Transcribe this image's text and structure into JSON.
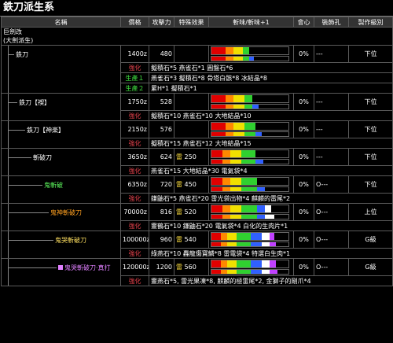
{
  "page_title": "鉄刀派生系",
  "headers": [
    "名稱",
    "價格",
    "攻擊力",
    "特殊效果",
    "斬味/斬味+1",
    "會心",
    "裝飾孔",
    "製作級別"
  ],
  "tree_labels": {
    "root": "巨劍改",
    "root_sub": "(大劍派生)",
    "n1": "鉄刀",
    "n2": "鉄刀【禊】",
    "n3": "鉄刀【神楽】",
    "n4": "斬破刀",
    "n5": "鬼斬破",
    "n6": "鬼神斬破刀",
    "n7": "鬼哭斬破刀",
    "n8": "鬼哭斬破刀·真打"
  },
  "labels": {
    "kyouka": "強化",
    "seisan1": "生產１",
    "seisan2": "生產２",
    "no_slot": "---",
    "slot1": "O---"
  },
  "rows": [
    {
      "price": "1400z",
      "atk": "480",
      "elem": "",
      "affinity": "0%",
      "slots": "---",
      "rank": "下位",
      "mats": [
        {
          "tag": "強化",
          "text": "擬積石*5 燕雀石*1 圓盤石*6"
        },
        {
          "tag": "生產１",
          "text": "燕雀石*3 擬積石*8 骨塔白骸*8 冰結晶*8"
        },
        {
          "tag": "生產２",
          "text": "累H*1 擬積石*1"
        }
      ],
      "sharp": [
        [
          18,
          "#e00000"
        ],
        [
          10,
          "#ff8800"
        ],
        [
          12,
          "#f0e000"
        ],
        [
          8,
          "#30d030"
        ]
      ],
      "sharp2": [
        [
          18,
          "#e00000"
        ],
        [
          10,
          "#ff8800"
        ],
        [
          12,
          "#f0e000"
        ],
        [
          8,
          "#30d030"
        ],
        [
          6,
          "#3060ff"
        ]
      ]
    },
    {
      "price": "1750z",
      "atk": "528",
      "elem": "",
      "affinity": "0%",
      "slots": "---",
      "rank": "下位",
      "mats": [
        {
          "tag": "強化",
          "text": "擬積石*10 燕雀石*10 大地結晶*10"
        }
      ],
      "sharp": [
        [
          18,
          "#e00000"
        ],
        [
          10,
          "#ff8800"
        ],
        [
          14,
          "#f0e000"
        ],
        [
          10,
          "#30d030"
        ]
      ],
      "sharp2": [
        [
          18,
          "#e00000"
        ],
        [
          10,
          "#ff8800"
        ],
        [
          14,
          "#f0e000"
        ],
        [
          10,
          "#30d030"
        ],
        [
          8,
          "#3060ff"
        ]
      ]
    },
    {
      "price": "2150z",
      "atk": "576",
      "elem": "",
      "affinity": "0%",
      "slots": "---",
      "rank": "下位",
      "mats": [
        {
          "tag": "強化",
          "text": "擬積石*15 燕雀石*12 大地結晶*15"
        }
      ],
      "sharp": [
        [
          18,
          "#e00000"
        ],
        [
          10,
          "#ff8800"
        ],
        [
          14,
          "#f0e000"
        ],
        [
          14,
          "#30d030"
        ]
      ],
      "sharp2": [
        [
          18,
          "#e00000"
        ],
        [
          10,
          "#ff8800"
        ],
        [
          14,
          "#f0e000"
        ],
        [
          14,
          "#30d030"
        ],
        [
          8,
          "#3060ff"
        ]
      ]
    },
    {
      "price": "3650z",
      "atk": "624",
      "elem": "雷 250",
      "affinity": "0%",
      "slots": "---",
      "rank": "下位",
      "mats": [
        {
          "tag": "強化",
          "text": "燕雀石*15 大地結晶*30 電氣袋*4"
        }
      ],
      "sharp": [
        [
          14,
          "#e00000"
        ],
        [
          10,
          "#ff8800"
        ],
        [
          14,
          "#f0e000"
        ],
        [
          18,
          "#30d030"
        ]
      ],
      "sharp2": [
        [
          14,
          "#e00000"
        ],
        [
          10,
          "#ff8800"
        ],
        [
          14,
          "#f0e000"
        ],
        [
          18,
          "#30d030"
        ],
        [
          10,
          "#3060ff"
        ]
      ]
    },
    {
      "price": "6350z",
      "atk": "720",
      "elem": "雷 450",
      "affinity": "0%",
      "slots": "O---",
      "rank": "下位",
      "mats": [
        {
          "tag": "強化",
          "text": "鎌鼬石*5 燕雀石*20 雷光袋出物*4 麒麟的雷尾*2"
        }
      ],
      "sharp": [
        [
          14,
          "#e00000"
        ],
        [
          10,
          "#ff8800"
        ],
        [
          14,
          "#f0e000"
        ],
        [
          20,
          "#30d030"
        ]
      ],
      "sharp2": [
        [
          14,
          "#e00000"
        ],
        [
          10,
          "#ff8800"
        ],
        [
          14,
          "#f0e000"
        ],
        [
          20,
          "#30d030"
        ],
        [
          10,
          "#3060ff"
        ]
      ]
    },
    {
      "price": "70000z",
      "atk": "816",
      "elem": "雷 520",
      "affinity": "0%",
      "slots": "O---",
      "rank": "上位",
      "mats": [
        {
          "tag": "強化",
          "text": "靈鶴石*10 鎌鼬石*20 電氣袋*4 白化的生肉片*1"
        }
      ],
      "sharp": [
        [
          14,
          "#e00000"
        ],
        [
          10,
          "#ff8800"
        ],
        [
          14,
          "#f0e000"
        ],
        [
          20,
          "#30d030"
        ],
        [
          10,
          "#3060ff"
        ],
        [
          8,
          "#ffffff"
        ]
      ],
      "sharp2": [
        [
          14,
          "#e00000"
        ],
        [
          10,
          "#ff8800"
        ],
        [
          14,
          "#f0e000"
        ],
        [
          20,
          "#30d030"
        ],
        [
          10,
          "#3060ff"
        ],
        [
          12,
          "#ffffff"
        ]
      ]
    },
    {
      "price": "100000z",
      "atk": "960",
      "elem": "雷 540",
      "affinity": "0%",
      "slots": "O---",
      "rank": "G級",
      "mats": [
        {
          "tag": "強化",
          "text": "綠燕石*10 轟龍傷寶鱗*8 雷電袋*4 特選白生肉*1"
        }
      ],
      "sharp": [
        [
          12,
          "#e00000"
        ],
        [
          8,
          "#ff8800"
        ],
        [
          12,
          "#f0e000"
        ],
        [
          18,
          "#30d030"
        ],
        [
          14,
          "#3060ff"
        ],
        [
          10,
          "#ffffff"
        ],
        [
          6,
          "#c040ff"
        ]
      ],
      "sharp2": [
        [
          12,
          "#e00000"
        ],
        [
          8,
          "#ff8800"
        ],
        [
          12,
          "#f0e000"
        ],
        [
          18,
          "#30d030"
        ],
        [
          14,
          "#3060ff"
        ],
        [
          10,
          "#ffffff"
        ],
        [
          8,
          "#c040ff"
        ]
      ]
    },
    {
      "price": "120000z",
      "atk": "1200",
      "elem": "雷 560",
      "affinity": "0%",
      "slots": "O---",
      "rank": "G級",
      "mats": [
        {
          "tag": "強化",
          "text": "靈燕石*5, 雷光果凍*8, 麒麟的極雷尾*2, 金獅子的剛爪*4"
        }
      ],
      "sharp": [
        [
          12,
          "#e00000"
        ],
        [
          8,
          "#ff8800"
        ],
        [
          12,
          "#f0e000"
        ],
        [
          18,
          "#30d030"
        ],
        [
          14,
          "#3060ff"
        ],
        [
          10,
          "#ffffff"
        ],
        [
          8,
          "#c040ff"
        ]
      ],
      "sharp2": [
        [
          12,
          "#e00000"
        ],
        [
          8,
          "#ff8800"
        ],
        [
          12,
          "#f0e000"
        ],
        [
          18,
          "#30d030"
        ],
        [
          14,
          "#3060ff"
        ],
        [
          10,
          "#ffffff"
        ],
        [
          10,
          "#c040ff"
        ]
      ]
    }
  ]
}
